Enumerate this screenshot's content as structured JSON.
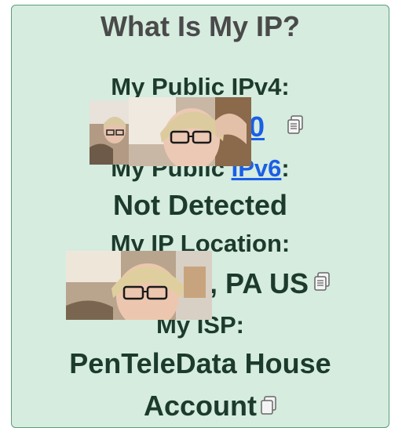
{
  "title": "What Is My IP?",
  "ipv4": {
    "label": "My Public IPv4:",
    "value_visible_fragment": "0"
  },
  "ipv6": {
    "label_prefix": "My Public ",
    "label_link": "IPv6",
    "label_suffix": ":",
    "value": "Not Detected"
  },
  "location": {
    "label": "My IP Location:",
    "value_visible_fragment": ", PA US"
  },
  "isp": {
    "label": "My ISP:",
    "value_line1": "PenTeleData House",
    "value_line2": "Account"
  },
  "icons": {
    "copy": "copy-icon",
    "photo": "user-photo-overlay"
  },
  "colors": {
    "card_background": "#d5ecdf",
    "card_border": "#5e9c7c",
    "text": "#1c3b2d",
    "link": "#1b5fe6",
    "title": "#4a4a4a"
  }
}
